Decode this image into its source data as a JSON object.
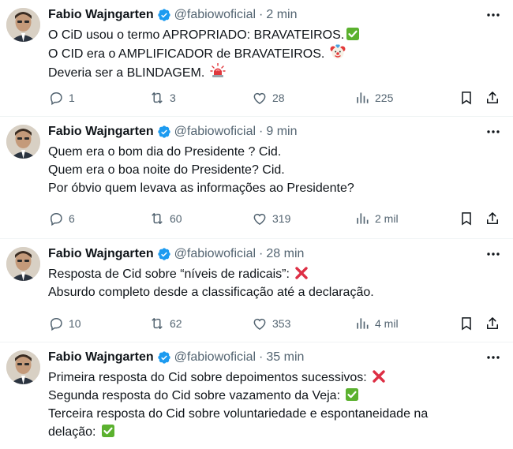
{
  "colors": {
    "text": "#0f1419",
    "secondary": "#536471",
    "verified": "#1d9bf0",
    "check_green": "#5bb12f",
    "cross_red": "#dd2e44",
    "divider": "#eff3f4"
  },
  "icons": {
    "verified": "verified-badge-icon",
    "more": "more-dots-icon",
    "reply": "reply-icon",
    "retweet": "retweet-icon",
    "like": "heart-icon",
    "views": "views-chart-icon",
    "bookmark": "bookmark-icon",
    "share": "share-icon"
  },
  "tweets": [
    {
      "name": "Fabio Wajngarten",
      "handle": "@fabiowoficial",
      "time": "2 min",
      "lines": [
        "O CiD usou o termo APROPRIADO: BRAVATEIROS.",
        "O CID era o AMPLIFICADOR de BRAVATEIROS.",
        "Deveria ser a BLINDAGEM."
      ],
      "line_emojis": [
        "check-mark-emoji",
        "clown-face-emoji",
        "police-light-emoji"
      ],
      "replies": "1",
      "retweets": "3",
      "likes": "28",
      "views": "225"
    },
    {
      "name": "Fabio Wajngarten",
      "handle": "@fabiowoficial",
      "time": "9 min",
      "lines": [
        "Quem era o bom dia do Presidente ? Cid.",
        "Quem era o boa noite do Presidente? Cid.",
        "Por óbvio quem levava as informações ao Presidente?"
      ],
      "replies": "6",
      "retweets": "60",
      "likes": "319",
      "views": "2 mil"
    },
    {
      "name": "Fabio Wajngarten",
      "handle": "@fabiowoficial",
      "time": "28 min",
      "lines": [
        "Resposta de Cid sobre “níveis de radicais”:",
        "Absurdo completo desde a classificação até a declaração."
      ],
      "line_emojis": [
        "cross-mark-emoji",
        ""
      ],
      "replies": "10",
      "retweets": "62",
      "likes": "353",
      "views": "4 mil"
    },
    {
      "name": "Fabio Wajngarten",
      "handle": "@fabiowoficial",
      "time": "35 min",
      "lines": [
        "Primeira resposta do Cid sobre depoimentos sucessivos:",
        "Segunda resposta do Cid sobre vazamento da Veja:",
        "Terceira resposta do Cid sobre voluntariedade e espontaneidade na",
        "delação:"
      ],
      "line_emojis": [
        "cross-mark-emoji",
        "check-mark-emoji",
        "",
        "check-mark-emoji"
      ]
    }
  ]
}
